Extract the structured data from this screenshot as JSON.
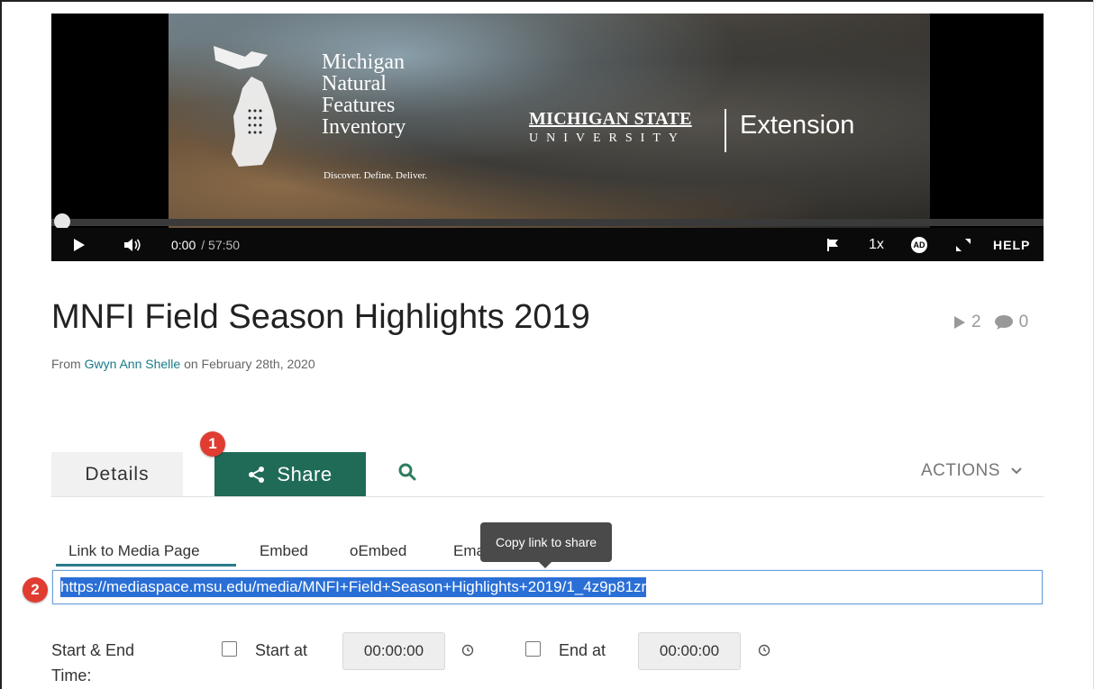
{
  "player": {
    "logo": {
      "line1": "Michigan",
      "line2": "Natural",
      "line3": "Features",
      "line4": "Inventory",
      "tagline": "Discover. Define. Deliver."
    },
    "msu": {
      "name": "MICHIGAN STATE",
      "university": "UNIVERSITY",
      "extension": "Extension"
    },
    "current_time": "0:00",
    "duration": "/ 57:50",
    "speed": "1x",
    "ad_badge": "AD",
    "help": "HELP",
    "progress": 0
  },
  "video": {
    "title": "MNFI Field Season Highlights 2019",
    "plays": "2",
    "comments": "0",
    "byline_from": "From",
    "author": "Gwyn Ann Shelle",
    "byline_date": "on February 28th, 2020"
  },
  "tabs": {
    "details": "Details",
    "share": "Share",
    "actions": "ACTIONS"
  },
  "markers": {
    "one": "1",
    "two": "2"
  },
  "share": {
    "subtabs": [
      "Link to Media Page",
      "Embed",
      "oEmbed",
      "Email"
    ],
    "tooltip": "Copy link to share",
    "url": "https://mediaspace.msu.edu/media/MNFI+Field+Season+Highlights+2019/1_4z9p81zr",
    "time_label_1": "Start & End",
    "time_label_2": "Time:",
    "start_label": "Start at",
    "start_value": "00:00:00",
    "end_label": "End at",
    "end_value": "00:00:00"
  },
  "colors": {
    "share_tab": "#1f6b57",
    "link": "#1a7a8a",
    "marker": "#e03c31",
    "selection": "#2a6fd6"
  }
}
